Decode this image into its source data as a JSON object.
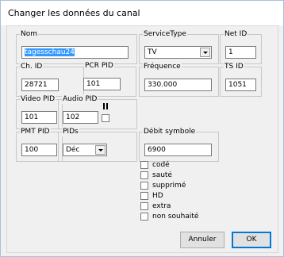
{
  "window": {
    "title": "Changer les données du canal"
  },
  "fields": {
    "nom": {
      "label": "Nom",
      "value": "tagesschau24"
    },
    "service_type": {
      "label": "ServiceType",
      "value": "TV"
    },
    "net_id": {
      "label": "Net ID",
      "value": "1"
    },
    "ch_id": {
      "label": "Ch. ID",
      "value": "28721"
    },
    "pcr_pid": {
      "label": "PCR PID",
      "value": "101"
    },
    "frequence": {
      "label": "Fréquence",
      "value": "330.000"
    },
    "ts_id": {
      "label": "TS ID",
      "value": "1051"
    },
    "video_pid": {
      "label": "Video PID",
      "value": "101"
    },
    "audio_pid": {
      "label": "Audio PID",
      "value": "102"
    },
    "pmt_pid": {
      "label": "PMT PID",
      "value": "100"
    },
    "pids": {
      "label": "PIDs",
      "value": "Déc"
    },
    "debit_symbole": {
      "label": "Débit symbole",
      "value": "6900"
    }
  },
  "flags": [
    {
      "label": "codé",
      "checked": false
    },
    {
      "label": "sauté",
      "checked": false
    },
    {
      "label": "supprimé",
      "checked": false
    },
    {
      "label": "HD",
      "checked": false
    },
    {
      "label": "extra",
      "checked": false
    },
    {
      "label": "non souhaité",
      "checked": false
    }
  ],
  "buttons": {
    "cancel": "Annuler",
    "ok": "OK"
  },
  "icons": {
    "combo_arrow": "chevron-down-icon",
    "audio_extra": "pause-icon"
  },
  "colors": {
    "selection": "#3399ff",
    "default_button_border": "#0078d7",
    "window_border": "#a9c0dc"
  }
}
